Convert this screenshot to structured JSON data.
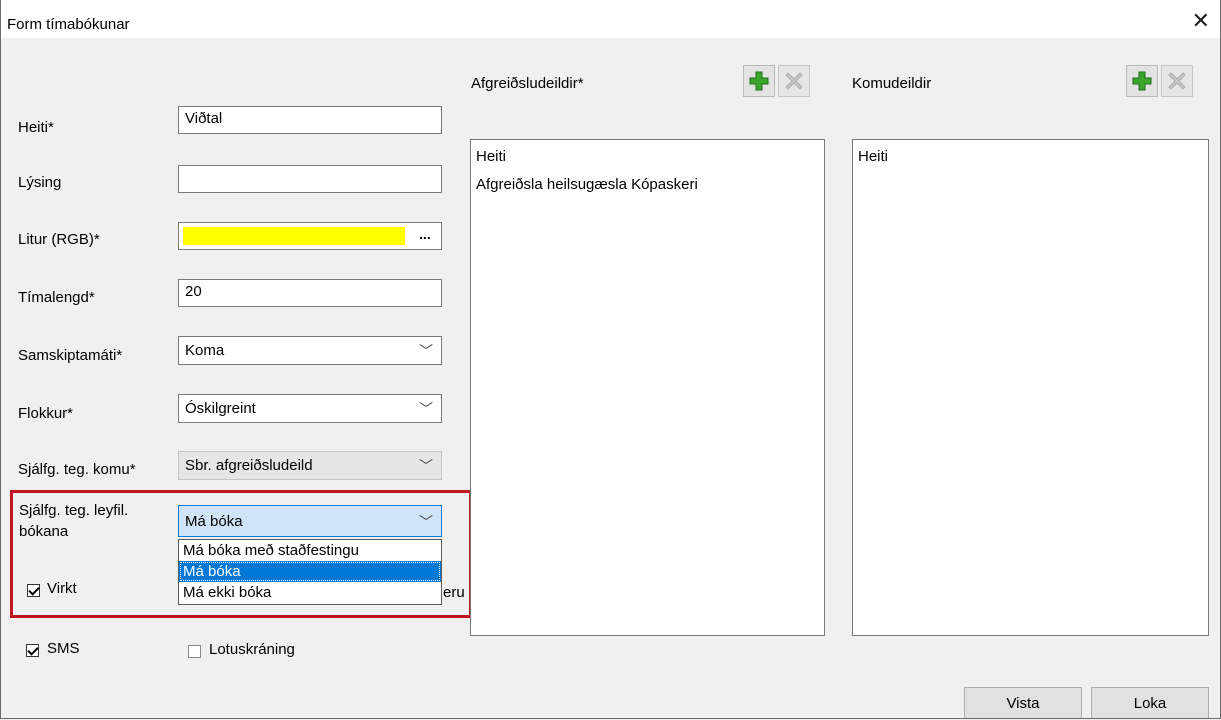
{
  "window": {
    "title": "Form tímabókunar",
    "close_glyph": "✕"
  },
  "form": {
    "heiti": {
      "label": "Heiti*",
      "value": "Viðtal"
    },
    "lysing": {
      "label": "Lýsing",
      "value": ""
    },
    "litur": {
      "label": "Litur (RGB)*",
      "color": "#ffff00",
      "button_label": "..."
    },
    "timalengd": {
      "label": "Tímalengd*",
      "value": "20"
    },
    "samskiptamati": {
      "label": "Samskiptamáti*",
      "value": "Koma"
    },
    "flokkur": {
      "label": "Flokkur*",
      "value": "Óskilgreint"
    },
    "sjalfg_komu": {
      "label": "Sjálfg. teg. komu*",
      "value": "Sbr. afgreiðsludeild",
      "disabled": true
    },
    "sjalfg_leyfil": {
      "label_line1": "Sjálfg. teg. leyfil.",
      "label_line2": "bókana",
      "value": "Má bóka",
      "options": [
        "Má bóka með staðfestingu",
        "Má bóka",
        "Má ekki bóka"
      ],
      "highlighted_option": "Má bóka"
    },
    "virkt": {
      "label": "Virkt",
      "checked": true
    },
    "hidden_partial_label": "eru",
    "sms": {
      "label": "SMS",
      "checked": true
    },
    "lotuskraning": {
      "label": "Lotuskráning",
      "checked": false
    }
  },
  "afgreidsludeildir": {
    "title": "Afgreiðsludeildir*",
    "column_header": "Heiti",
    "rows": [
      "Afgreiðsla heilsugæsla Kópaskeri"
    ],
    "add_icon": "green-plus-icon",
    "remove_icon": "gray-x-icon"
  },
  "komudeildir": {
    "title": "Komudeildir",
    "column_header": "Heiti",
    "rows": [],
    "add_icon": "green-plus-icon",
    "remove_icon": "gray-x-icon"
  },
  "buttons": {
    "save": "Vista",
    "close": "Loka"
  },
  "colors": {
    "highlight_border": "#c0161d",
    "selection": "#0078d7",
    "color_swatch": "#ffff00"
  }
}
